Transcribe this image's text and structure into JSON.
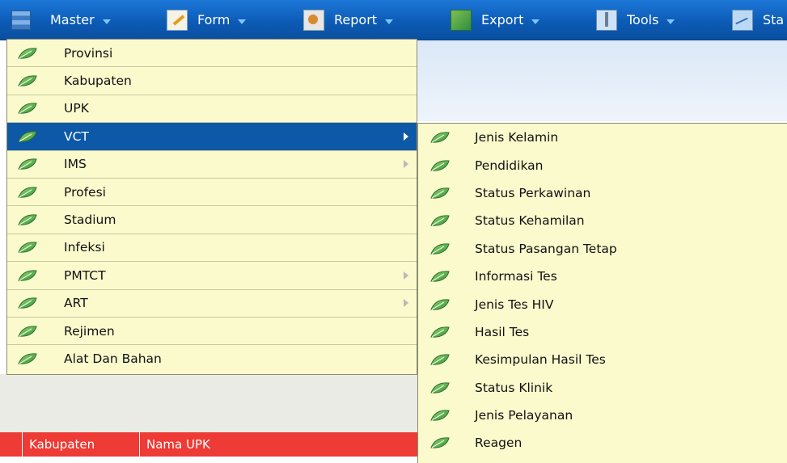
{
  "menubar": {
    "items": [
      {
        "label": "Master",
        "icon": "master-icon",
        "has_caret": true
      },
      {
        "label": "Form",
        "icon": "form-icon",
        "has_caret": true
      },
      {
        "label": "Report",
        "icon": "report-icon",
        "has_caret": true
      },
      {
        "label": "Export",
        "icon": "export-icon",
        "has_caret": true
      },
      {
        "label": "Tools",
        "icon": "tools-icon",
        "has_caret": true
      },
      {
        "label": "Sta",
        "icon": "statistic-icon",
        "has_caret": false
      }
    ]
  },
  "master_menu": {
    "items": [
      {
        "label": "Provinsi",
        "submenu": false,
        "active": false
      },
      {
        "label": "Kabupaten",
        "submenu": false,
        "active": false
      },
      {
        "label": "UPK",
        "submenu": false,
        "active": false
      },
      {
        "label": "VCT",
        "submenu": true,
        "active": true
      },
      {
        "label": "IMS",
        "submenu": true,
        "active": false
      },
      {
        "label": "Profesi",
        "submenu": false,
        "active": false
      },
      {
        "label": "Stadium",
        "submenu": false,
        "active": false
      },
      {
        "label": "Infeksi",
        "submenu": false,
        "active": false
      },
      {
        "label": "PMTCT",
        "submenu": true,
        "active": false
      },
      {
        "label": "ART",
        "submenu": true,
        "active": false
      },
      {
        "label": "Rejimen",
        "submenu": false,
        "active": false
      },
      {
        "label": "Alat Dan Bahan",
        "submenu": false,
        "active": false
      }
    ]
  },
  "vct_submenu": {
    "items": [
      {
        "label": "Jenis Kelamin"
      },
      {
        "label": "Pendidikan"
      },
      {
        "label": "Status Perkawinan"
      },
      {
        "label": "Status Kehamilan"
      },
      {
        "label": "Status Pasangan Tetap"
      },
      {
        "label": "Informasi Tes"
      },
      {
        "label": "Jenis Tes HIV"
      },
      {
        "label": "Hasil Tes"
      },
      {
        "label": "Kesimpulan Hasil Tes"
      },
      {
        "label": "Status Klinik"
      },
      {
        "label": "Jenis Pelayanan"
      },
      {
        "label": "Reagen"
      }
    ]
  },
  "table": {
    "columns": [
      "Kabupaten",
      "Nama UPK"
    ]
  },
  "colors": {
    "menubar": "#0c5bb6",
    "menu_bg": "#fafacd",
    "active_item": "#0e58a8",
    "table_header": "#ee3b35",
    "leaf_icon": "#3aa24a"
  }
}
